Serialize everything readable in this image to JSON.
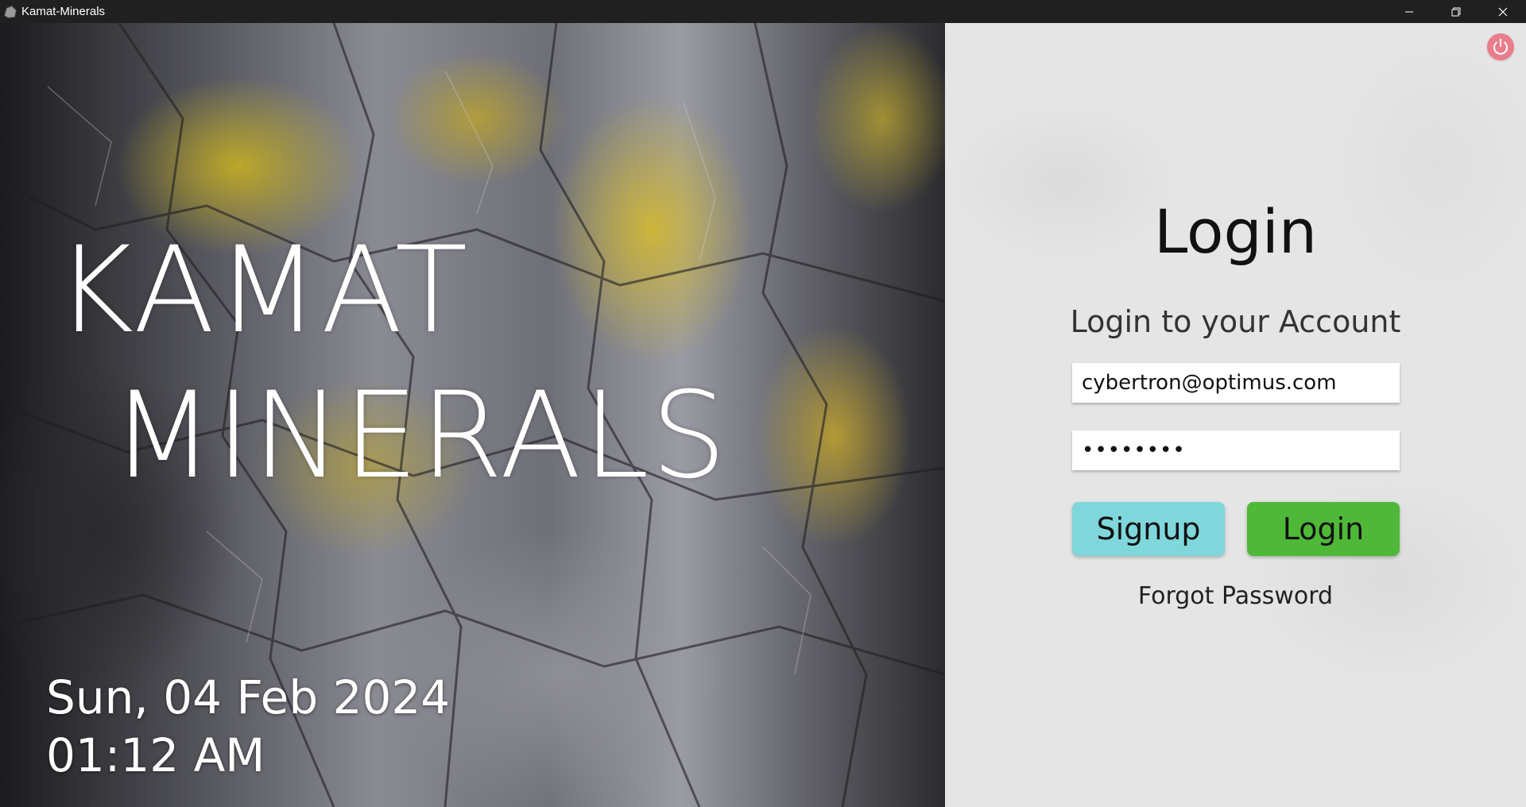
{
  "window": {
    "title": "Kamat-Minerals",
    "controls": [
      "minimize-icon",
      "restore-icon",
      "close-icon"
    ]
  },
  "branding": {
    "line1": "KAMAT",
    "line2": "MINERALS"
  },
  "clock": {
    "date": "Sun, 04 Feb 2024",
    "time": "01:12 AM"
  },
  "login": {
    "title": "Login",
    "subtitle": "Login to your Account",
    "email_value": "cybertron@optimus.com",
    "password_masked": "••••••••",
    "signup_label": "Signup",
    "login_label": "Login",
    "forgot_label": "Forgot Password"
  },
  "colors": {
    "titlebar": "#202020",
    "signup_button": "#7fd7db",
    "login_button": "#4fb839",
    "power_button": "#ea7d8b"
  },
  "icons": {
    "power": "power-icon",
    "app": "mineral-rock-icon"
  }
}
